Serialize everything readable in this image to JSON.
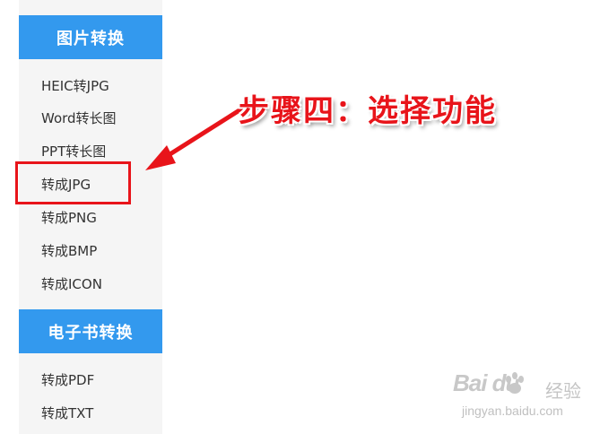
{
  "sidebar": {
    "image_section": {
      "title": "图片转换",
      "items": [
        {
          "label": "HEIC转JPG"
        },
        {
          "label": "Word转长图"
        },
        {
          "label": "PPT转长图"
        },
        {
          "label": "转成JPG"
        },
        {
          "label": "转成PNG"
        },
        {
          "label": "转成BMP"
        },
        {
          "label": "转成ICON"
        }
      ]
    },
    "ebook_section": {
      "title": "电子书转换",
      "items": [
        {
          "label": "转成PDF"
        },
        {
          "label": "转成TXT"
        }
      ]
    }
  },
  "annotation": {
    "text": "步骤四：选择功能",
    "color": "#e8141a"
  },
  "colors": {
    "accent": "#3399ee",
    "sidebar_bg": "#f5f5f5",
    "highlight": "#e8141a"
  },
  "watermark": {
    "logo": "Bai du",
    "jingyan": "经验",
    "url": "jingyan.baidu.com"
  }
}
